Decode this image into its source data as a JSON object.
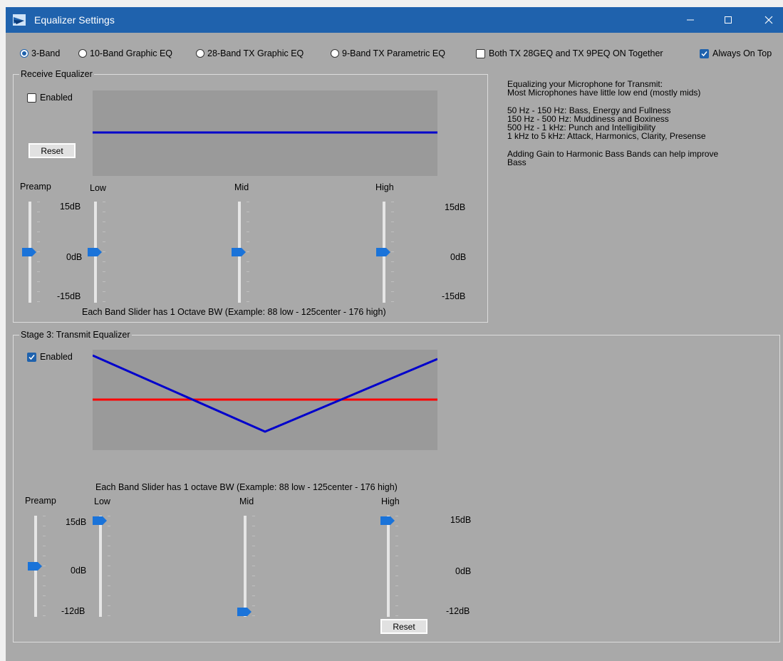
{
  "window": {
    "title": "Equalizer Settings",
    "controls": [
      "minimize",
      "maximize",
      "close"
    ],
    "accent": "#1f62ad"
  },
  "mode_options": [
    {
      "label": "3-Band",
      "type": "radio",
      "checked": true
    },
    {
      "label": "10-Band Graphic EQ",
      "type": "radio",
      "checked": false
    },
    {
      "label": "28-Band TX Graphic EQ",
      "type": "radio",
      "checked": false
    },
    {
      "label": "9-Band TX Parametric EQ",
      "type": "radio",
      "checked": false
    },
    {
      "label": "Both TX 28GEQ and TX 9PEQ ON Together",
      "type": "checkbox",
      "checked": false
    },
    {
      "label": "Always On Top",
      "type": "checkbox",
      "checked": true
    }
  ],
  "receive": {
    "legend": "Receive Equalizer",
    "enabled_label": "Enabled",
    "enabled": false,
    "reset_label": "Reset",
    "preamp_label": "Preamp",
    "low_label": "Low",
    "mid_label": "Mid",
    "high_label": "High",
    "left_scale": {
      "top": "15dB",
      "mid": "0dB",
      "bottom": "-15dB"
    },
    "right_scale": {
      "top": "15dB",
      "mid": "0dB",
      "bottom": "-15dB"
    },
    "note": "Each Band Slider has 1 Octave BW (Example: 88 low - 125center  - 176 high)",
    "slider_levels_db": {
      "preamp": 0,
      "low": 0,
      "mid": 0,
      "high": 0
    },
    "curve_color": "#0000cc"
  },
  "transmit": {
    "legend": "Stage 3: Transmit Equalizer",
    "enabled_label": "Enabled",
    "enabled": true,
    "reset_label": "Reset",
    "preamp_label": "Preamp",
    "low_label": "Low",
    "mid_label": "Mid",
    "high_label": "High",
    "left_scale": {
      "top": "15dB",
      "mid": "0dB",
      "bottom": "-12dB"
    },
    "right_scale": {
      "top": "15dB",
      "mid": "0dB",
      "bottom": "-12dB"
    },
    "note": "Each Band Slider has 1 octave BW (Example: 88 low - 125center  - 176 high)",
    "slider_levels_db": {
      "preamp": 0,
      "low": 15,
      "mid": -12,
      "high": 15
    },
    "curve_color": "#0000cc",
    "baseline_color": "#ff0000"
  },
  "info_text": [
    "Equalizing your Microphone for Transmit:",
    "Most Microphones have little low end (mostly mids)",
    "",
    "50 Hz - 150 Hz: Bass, Energy and Fullness",
    "150 Hz - 500 Hz: Muddiness and Boxiness",
    "500 Hz - 1 kHz: Punch and Intelligibility",
    "1 kHz to 5 kHz: Attack, Harmonics, Clarity, Presense",
    "",
    "Adding Gain to Harmonic Bass Bands can help improve",
    "Bass"
  ]
}
